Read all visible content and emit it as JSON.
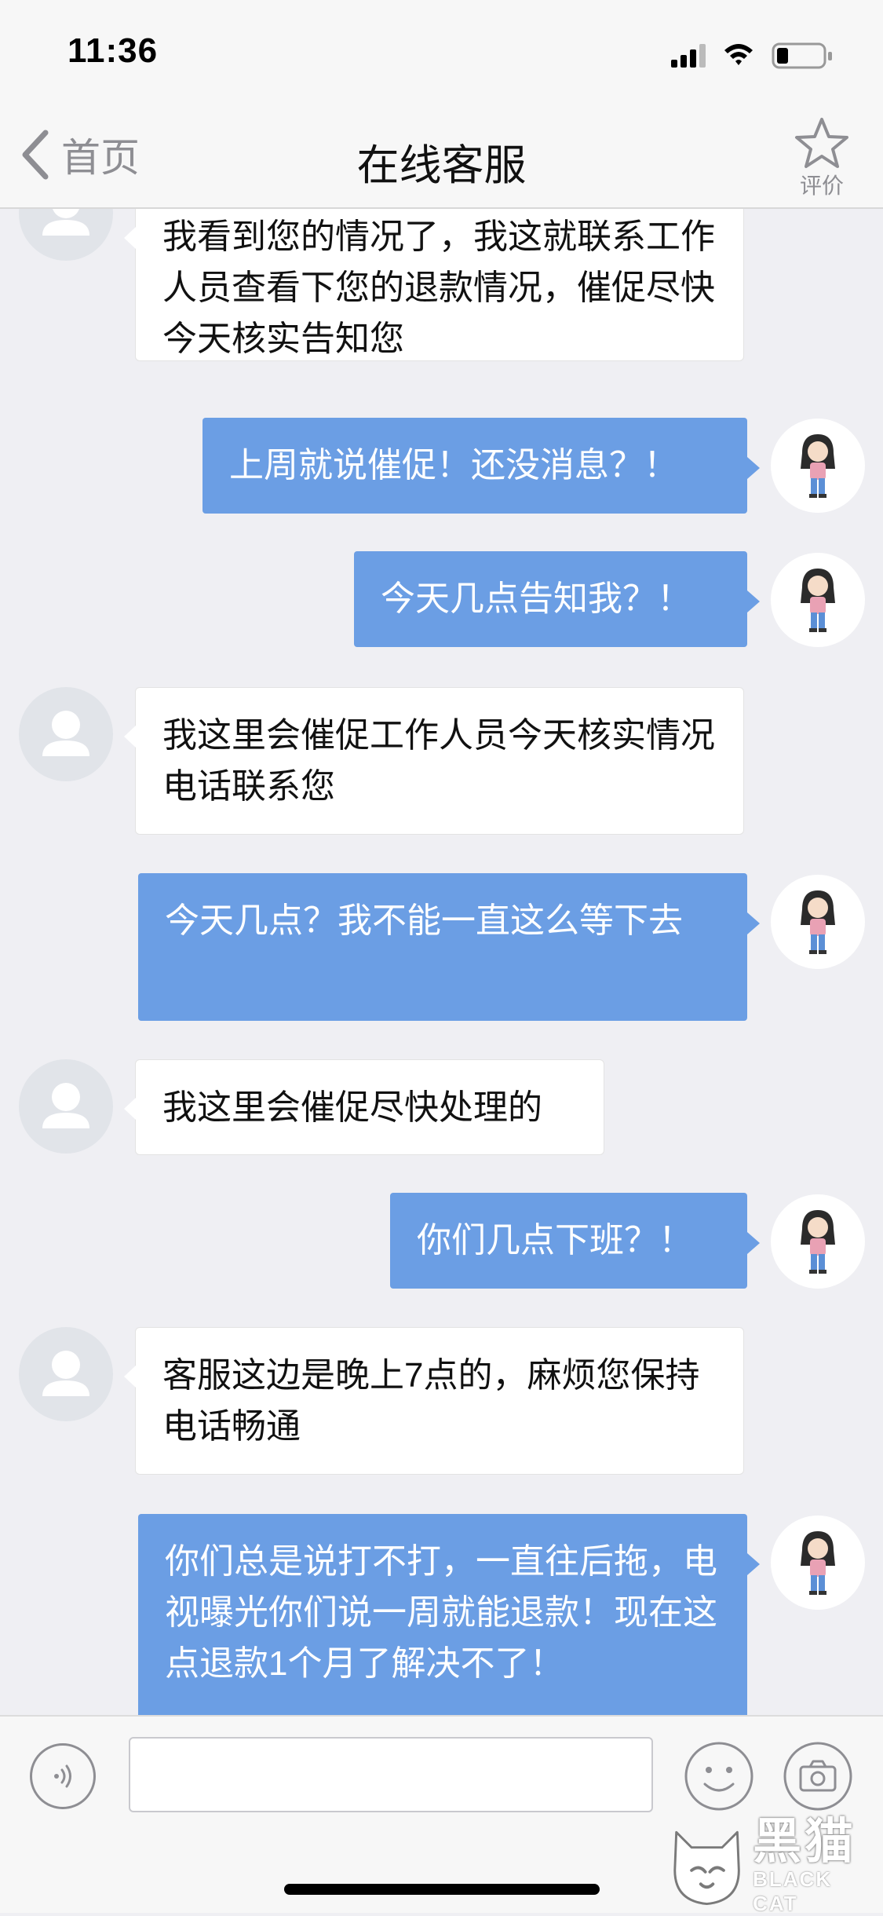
{
  "status_bar": {
    "time": "11:36"
  },
  "nav": {
    "back_label": "首页",
    "title": "在线客服",
    "rate_label": "评价"
  },
  "messages": [
    {
      "from": "agent",
      "text": "我看到您的情况了，我这就联系工作人员查看下您的退款情况，催促尽快今天核实告知您"
    },
    {
      "from": "user",
      "text": "上周就说催促！还没消息？！"
    },
    {
      "from": "user",
      "text": "今天几点告知我？！"
    },
    {
      "from": "agent",
      "text": "我这里会催促工作人员今天核实情况电话联系您"
    },
    {
      "from": "user",
      "text": "今天几点？我不能一直这么等下去"
    },
    {
      "from": "agent",
      "text": "我这里会催促尽快处理的"
    },
    {
      "from": "user",
      "text": "你们几点下班？！"
    },
    {
      "from": "agent",
      "text": "客服这边是晚上7点的，麻烦您保持电话畅通"
    },
    {
      "from": "user",
      "text": "你们总是说打不打，一直往后拖，电视曝光你们说一周就能退款！现在这点退款1个月了解决不了！"
    }
  ],
  "input_bar": {
    "value": "",
    "placeholder": ""
  },
  "watermark": {
    "cn": "黑猫",
    "en": "BLACK CAT"
  },
  "colors": {
    "user_bubble": "#6b9ee4",
    "agent_bubble": "#ffffff",
    "background": "#efeff3"
  }
}
